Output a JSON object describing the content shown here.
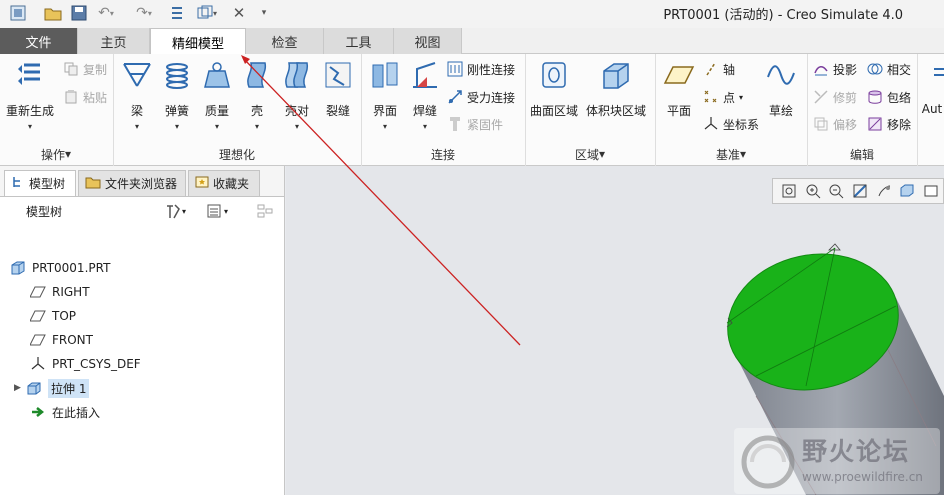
{
  "window": {
    "title": "PRT0001 (活动的) - Creo Simulate 4.0"
  },
  "tabs": [
    {
      "label": "文件"
    },
    {
      "label": "主页"
    },
    {
      "label": "精细模型",
      "active": true
    },
    {
      "label": "检查"
    },
    {
      "label": "工具"
    },
    {
      "label": "视图"
    }
  ],
  "ribbon": {
    "operations": {
      "label": "操作",
      "regenerate": "重新生成",
      "copy": "复制",
      "paste": "粘贴"
    },
    "idealization": {
      "label": "理想化",
      "beam": "梁",
      "spring": "弹簧",
      "mass": "质量",
      "shell": "壳",
      "shell_pair": "壳对",
      "crack": "裂缝"
    },
    "connection": {
      "label": "连接",
      "interface": "界面",
      "weld": "焊缝",
      "rigid_link": "刚性连接",
      "weighted_link": "受力连接",
      "fastener": "紧固件"
    },
    "region": {
      "label": "区域",
      "surface_region": "曲面区域",
      "volume_region": "体积块区域"
    },
    "datum": {
      "label": "基准",
      "plane": "平面",
      "axis": "轴",
      "point": "点",
      "csys": "坐标系",
      "sketch": "草绘"
    },
    "edit": {
      "label": "编辑",
      "project": "投影",
      "intersect": "相交",
      "trim": "修剪",
      "wrap": "包络",
      "offset": "偏移",
      "remove": "移除"
    },
    "auto": "Aut"
  },
  "left_panel": {
    "tabs": [
      "模型树",
      "文件夹浏览器",
      "收藏夹"
    ],
    "header": "模型树",
    "tree": [
      {
        "label": "PRT0001.PRT",
        "icon": "part-icon"
      },
      {
        "label": "RIGHT",
        "icon": "datum-plane-icon"
      },
      {
        "label": "TOP",
        "icon": "datum-plane-icon"
      },
      {
        "label": "FRONT",
        "icon": "datum-plane-icon"
      },
      {
        "label": "PRT_CSYS_DEF",
        "icon": "csys-icon"
      },
      {
        "label": "拉伸 1",
        "icon": "extrude-icon",
        "selected": true
      },
      {
        "label": "在此插入",
        "icon": "insert-arrow-icon"
      }
    ]
  },
  "watermark": {
    "title": "野火论坛",
    "url": "www.proewildfire.cn"
  },
  "colors": {
    "accent_green": "#19b219",
    "file_tab": "#5c5c5c",
    "annotation_red": "#cc2222",
    "selection": "#cfe3f6"
  }
}
